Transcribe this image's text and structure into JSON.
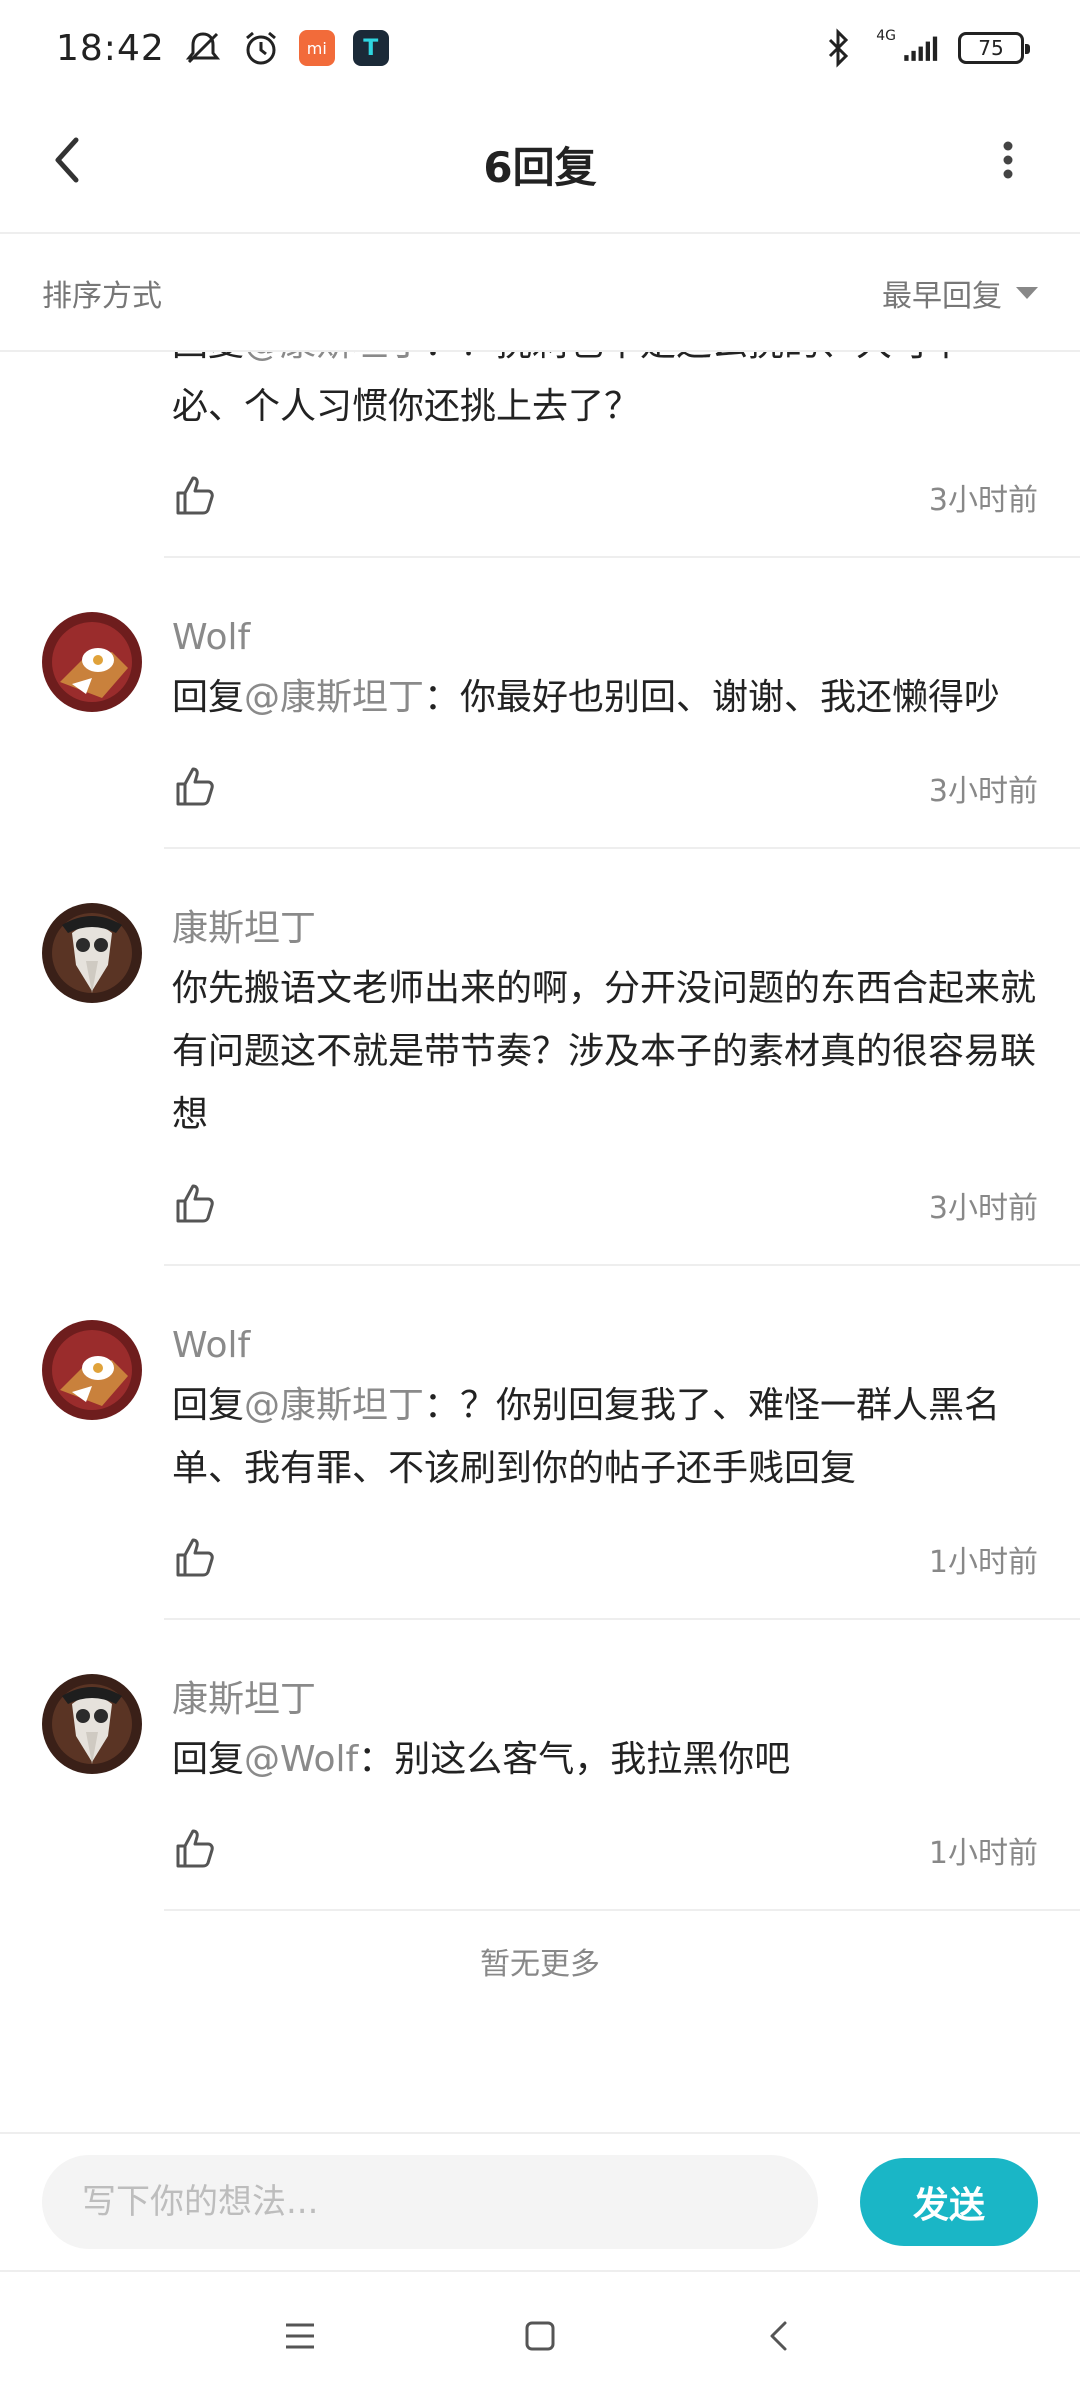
{
  "status_bar": {
    "time": "18:42",
    "network": "4G",
    "battery": "75",
    "app_badge_1": "mi",
    "app_badge_2": "T"
  },
  "header": {
    "title": "6回复"
  },
  "sort": {
    "label": "排序方式",
    "value": "最早回复"
  },
  "replies": [
    {
      "name": "",
      "prefix": "回复",
      "mention": "@康斯坦丁",
      "text_partial": "：？挑刺也不是这么挑的、大可不",
      "text": "必、个人习惯你还挑上去了？",
      "time": "3小时前",
      "avatar": "fox"
    },
    {
      "name": "Wolf",
      "prefix": "回复",
      "mention": "@康斯坦丁",
      "text": "：你最好也别回、谢谢、我还懒得吵",
      "time": "3小时前",
      "avatar": "fox"
    },
    {
      "name": "康斯坦丁",
      "prefix": "",
      "mention": "",
      "text": "你先搬语文老师出来的啊，分开没问题的东西合起来就有问题这不就是带节奏？涉及本子的素材真的很容易联想",
      "time": "3小时前",
      "avatar": "plague"
    },
    {
      "name": "Wolf",
      "prefix": "回复",
      "mention": "@康斯坦丁",
      "text": "：？你别回复我了、难怪一群人黑名单、我有罪、不该刷到你的帖子还手贱回复",
      "time": "1小时前",
      "avatar": "fox"
    },
    {
      "name": "康斯坦丁",
      "prefix": "回复",
      "mention": "@Wolf",
      "text": "：别这么客气，我拉黑你吧",
      "time": "1小时前",
      "avatar": "plague"
    }
  ],
  "no_more": "暂无更多",
  "composer": {
    "placeholder": "写下你的想法...",
    "send_label": "发送"
  },
  "colors": {
    "accent": "#1ab6c6",
    "muted": "#8a8a8a",
    "divider": "#eeeeee"
  }
}
